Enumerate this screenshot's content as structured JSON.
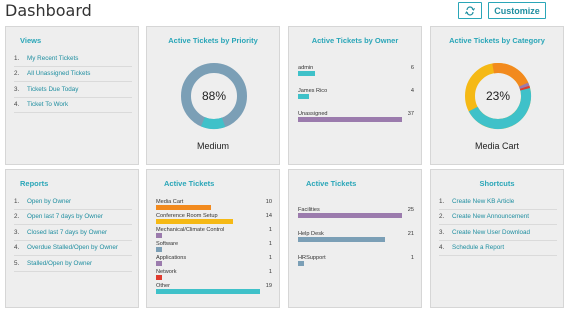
{
  "header": {
    "title": "Dashboard",
    "customize_label": "Customize",
    "refresh_icon": "refresh-icon"
  },
  "colors": {
    "accent": "#2aa6b8",
    "card_bg": "#eeeeee",
    "purple": "#9b7bad",
    "steel": "#7b9fb6",
    "teal": "#3fc1c9",
    "orange": "#f28a1e",
    "yellow": "#f5b915",
    "red": "#e03b2f"
  },
  "views": {
    "title": "Views",
    "items": [
      {
        "num": "1.",
        "label": "My Recent Tickets"
      },
      {
        "num": "2.",
        "label": "All Unassigned Tickets"
      },
      {
        "num": "3.",
        "label": "Tickets Due Today"
      },
      {
        "num": "4.",
        "label": "Ticket To Work"
      }
    ]
  },
  "priority": {
    "title": "Active Tickets by Priority",
    "percent": "88%",
    "caption": "Medium",
    "fraction": 0.88
  },
  "owner": {
    "title": "Active Tickets by Owner",
    "rows": [
      {
        "label": "admin",
        "count": "6",
        "value": 6
      },
      {
        "label": "James Rico",
        "count": "4",
        "value": 4
      },
      {
        "label": "Unassigned",
        "count": "37",
        "value": 37
      }
    ],
    "max": 37
  },
  "category": {
    "title": "Active Tickets by Category",
    "percent": "23%",
    "caption": "Media Cart"
  },
  "reports": {
    "title": "Reports",
    "items": [
      {
        "num": "1.",
        "label": "Open by Owner"
      },
      {
        "num": "2.",
        "label": "Open last 7 days by Owner"
      },
      {
        "num": "3.",
        "label": "Closed last 7 days by Owner"
      },
      {
        "num": "4.",
        "label": "Overdue Stalled/Open by Owner"
      },
      {
        "num": "5.",
        "label": "Stalled/Open by Owner"
      }
    ]
  },
  "active_tickets_1": {
    "title": "Active Tickets",
    "rows": [
      {
        "label": "Media Cart",
        "count": "10",
        "value": 10,
        "color": "#f28a1e"
      },
      {
        "label": "Conference Room Setup",
        "count": "14",
        "value": 14,
        "color": "#f5b915"
      },
      {
        "label": "Mechanical/Climate Control",
        "count": "1",
        "value": 1,
        "color": "#9b7bad"
      },
      {
        "label": "Software",
        "count": "1",
        "value": 1,
        "color": "#7b9fb6"
      },
      {
        "label": "Applications",
        "count": "1",
        "value": 1,
        "color": "#9b7bad"
      },
      {
        "label": "Network",
        "count": "1",
        "value": 1,
        "color": "#e03b2f"
      },
      {
        "label": "Other",
        "count": "19",
        "value": 19,
        "color": "#3fc1c9"
      }
    ],
    "max": 19
  },
  "active_tickets_2": {
    "title": "Active Tickets",
    "rows": [
      {
        "label": "Facilities",
        "count": "25",
        "value": 25,
        "color": "#9b7bad"
      },
      {
        "label": "Help Desk",
        "count": "21",
        "value": 21,
        "color": "#7b9fb6"
      },
      {
        "label": "HRSupport",
        "count": "1",
        "value": 1,
        "color": "#7b9fb6"
      }
    ],
    "max": 25
  },
  "shortcuts": {
    "title": "Shortcuts",
    "items": [
      {
        "num": "1.",
        "label": "Create New KB Article"
      },
      {
        "num": "2.",
        "label": "Create New Announcement"
      },
      {
        "num": "3.",
        "label": "Create New User Download"
      },
      {
        "num": "4.",
        "label": "Schedule a Report"
      }
    ]
  }
}
